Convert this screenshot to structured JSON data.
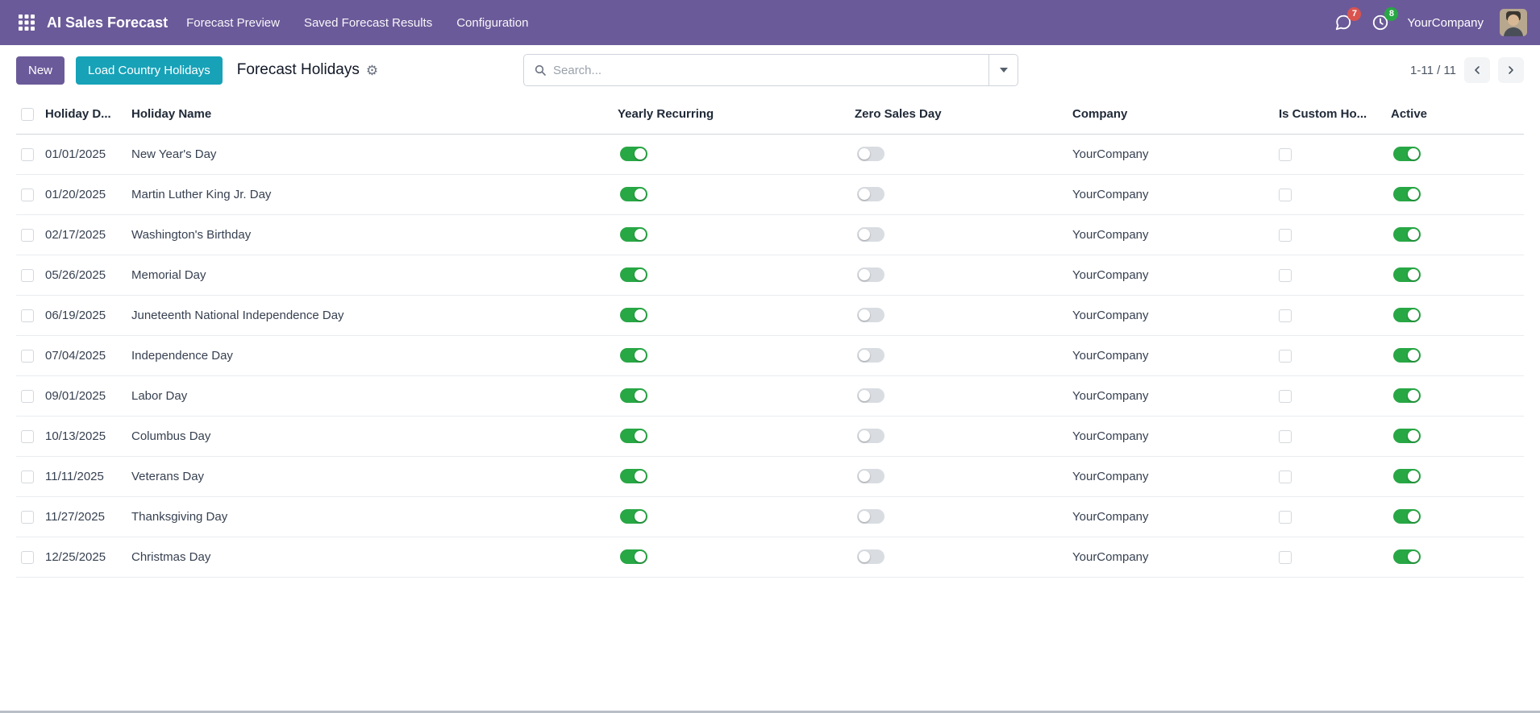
{
  "navbar": {
    "app_name": "AI Sales Forecast",
    "menus": [
      "Forecast Preview",
      "Saved Forecast Results",
      "Configuration"
    ],
    "messages_badge": "7",
    "activities_badge": "8",
    "company": "YourCompany"
  },
  "control_panel": {
    "new_label": "New",
    "load_label": "Load Country Holidays",
    "title": "Forecast Holidays",
    "search_placeholder": "Search...",
    "pager_text": "1-11 / 11"
  },
  "table": {
    "columns": [
      "Holiday D...",
      "Holiday Name",
      "Yearly Recurring",
      "Zero Sales Day",
      "Company",
      "Is Custom Ho...",
      "Active"
    ],
    "rows": [
      {
        "date": "01/01/2025",
        "name": "New Year's Day",
        "yearly": true,
        "zero": false,
        "company": "YourCompany",
        "custom": false,
        "active": true
      },
      {
        "date": "01/20/2025",
        "name": "Martin Luther King Jr. Day",
        "yearly": true,
        "zero": false,
        "company": "YourCompany",
        "custom": false,
        "active": true
      },
      {
        "date": "02/17/2025",
        "name": "Washington's Birthday",
        "yearly": true,
        "zero": false,
        "company": "YourCompany",
        "custom": false,
        "active": true
      },
      {
        "date": "05/26/2025",
        "name": "Memorial Day",
        "yearly": true,
        "zero": false,
        "company": "YourCompany",
        "custom": false,
        "active": true
      },
      {
        "date": "06/19/2025",
        "name": "Juneteenth National Independence Day",
        "yearly": true,
        "zero": false,
        "company": "YourCompany",
        "custom": false,
        "active": true
      },
      {
        "date": "07/04/2025",
        "name": "Independence Day",
        "yearly": true,
        "zero": false,
        "company": "YourCompany",
        "custom": false,
        "active": true
      },
      {
        "date": "09/01/2025",
        "name": "Labor Day",
        "yearly": true,
        "zero": false,
        "company": "YourCompany",
        "custom": false,
        "active": true
      },
      {
        "date": "10/13/2025",
        "name": "Columbus Day",
        "yearly": true,
        "zero": false,
        "company": "YourCompany",
        "custom": false,
        "active": true
      },
      {
        "date": "11/11/2025",
        "name": "Veterans Day",
        "yearly": true,
        "zero": false,
        "company": "YourCompany",
        "custom": false,
        "active": true
      },
      {
        "date": "11/27/2025",
        "name": "Thanksgiving Day",
        "yearly": true,
        "zero": false,
        "company": "YourCompany",
        "custom": false,
        "active": true
      },
      {
        "date": "12/25/2025",
        "name": "Christmas Day",
        "yearly": true,
        "zero": false,
        "company": "YourCompany",
        "custom": false,
        "active": true
      }
    ]
  },
  "colors": {
    "navbar_bg": "#6b5a99",
    "accent_purple": "#6b5a99",
    "accent_teal": "#17a2b8",
    "toggle_on": "#28a745",
    "toggle_off": "#d9dde2",
    "badge_messages": "#d9534f",
    "badge_activities": "#28a745"
  }
}
